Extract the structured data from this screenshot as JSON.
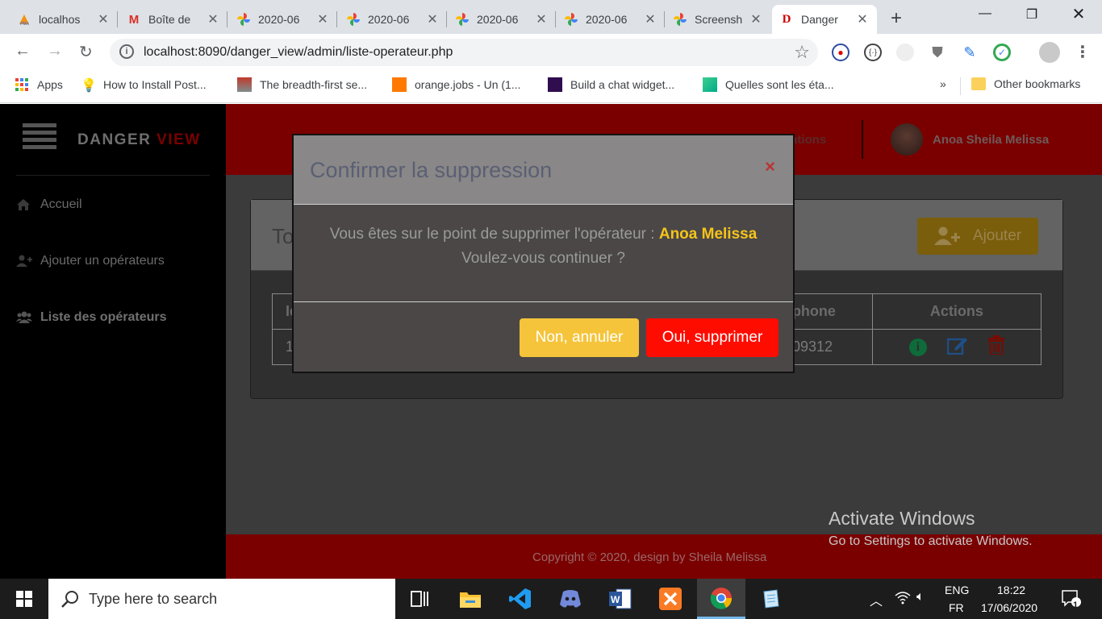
{
  "browser": {
    "tabs": [
      {
        "title": "localhos",
        "favicon": "phpmyadmin-icon"
      },
      {
        "title": "Boîte de",
        "favicon": "gmail-icon"
      },
      {
        "title": "2020-06",
        "favicon": "google-photos-icon"
      },
      {
        "title": "2020-06",
        "favicon": "google-photos-icon"
      },
      {
        "title": "2020-06",
        "favicon": "google-photos-icon"
      },
      {
        "title": "2020-06",
        "favicon": "google-photos-icon"
      },
      {
        "title": "Screensh",
        "favicon": "google-photos-icon"
      },
      {
        "title": "Danger",
        "favicon": "danger-view-icon",
        "active": true
      }
    ],
    "url": "localhost:8090/danger_view/admin/liste-operateur.php",
    "bookmarks": [
      {
        "label": "Apps"
      },
      {
        "label": "How to Install Post..."
      },
      {
        "label": "The breadth-first se..."
      },
      {
        "label": "orange.jobs - Un (1..."
      },
      {
        "label": "Build a chat widget..."
      },
      {
        "label": "Quelles sont les éta..."
      }
    ],
    "bookmarks_overflow": "»",
    "other_bookmarks": "Other bookmarks"
  },
  "app": {
    "brand_primary": "DANGER",
    "brand_secondary": "VIEW",
    "sidebar": [
      {
        "label": "Accueil",
        "icon": "home-icon"
      },
      {
        "label": "Ajouter un opérateurs",
        "icon": "add-user-icon"
      },
      {
        "label": "Liste des opérateurs",
        "icon": "users-icon",
        "active": true
      }
    ],
    "topbar": {
      "notifications_partial": "ations",
      "user_name": "Anoa Sheila Melissa"
    },
    "card": {
      "title_partial": "To",
      "add_button": "Ajouter",
      "columns": [
        "Id",
        "",
        "",
        "",
        "",
        "phone",
        "Actions"
      ],
      "rows": [
        {
          "id": "1",
          "phone_partial": "09312"
        }
      ]
    },
    "footer": "Copyright © 2020, design by Sheila Melissa"
  },
  "modal": {
    "title": "Confirmer la suppression",
    "close": "×",
    "message": "Vous êtes sur le point de supprimer l'opérateur :",
    "operator_name": "Anoa Melissa",
    "question": "Voulez-vous continuer ?",
    "cancel_label": "Non, annuler",
    "confirm_label": "Oui, supprimer"
  },
  "watermark": {
    "line1": "Activate Windows",
    "line2": "Go to Settings to activate Windows."
  },
  "taskbar": {
    "search_placeholder": "Type here to search",
    "lang_top": "ENG",
    "lang_bottom": "FR",
    "time": "18:22",
    "date": "17/06/2020",
    "notif_count": "1"
  },
  "colors": {
    "brand_red": "#7a0000",
    "confirm_red": "#ff0c00",
    "cancel_yellow": "#f5c43a",
    "highlight_yellow": "#f5c419"
  }
}
